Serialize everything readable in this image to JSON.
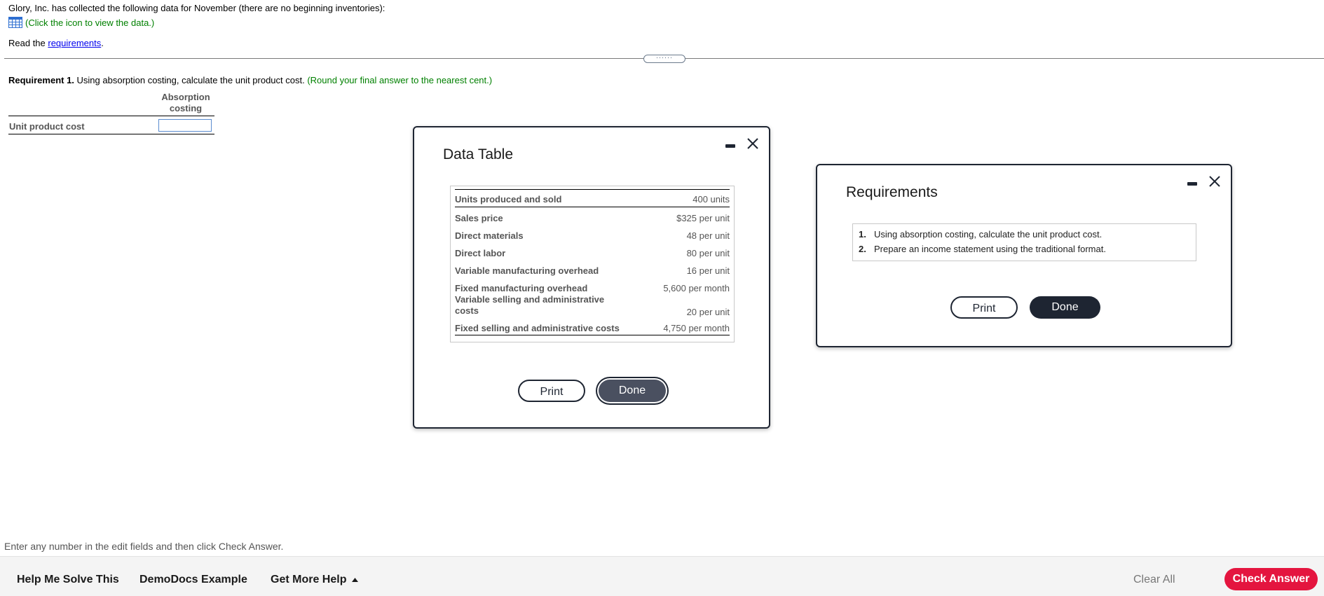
{
  "question": {
    "intro": "Glory, Inc. has collected the following data for November (there are no beginning inventories):",
    "data_link": "(Click the icon to view the data.)",
    "read_prefix": "Read the ",
    "read_link": "requirements",
    "read_suffix": ".",
    "req1_bold": "Requirement 1.",
    "req1_text": " Using absorption costing, calculate the unit product cost.",
    "req1_hint": " (Round your final answer to the nearest cent.)",
    "column_header": "Absorption costing",
    "row_label": "Unit product cost",
    "row_value": ""
  },
  "data_table_modal": {
    "title": "Data Table",
    "rows": [
      {
        "label": "Units produced and sold",
        "value": "400 units"
      },
      {
        "label": "Sales price",
        "value": "$325 per unit"
      },
      {
        "label": "Direct materials",
        "value": "48 per unit"
      },
      {
        "label": "Direct labor",
        "value": "80 per unit"
      },
      {
        "label": "Variable manufacturing overhead",
        "value": "16 per unit"
      },
      {
        "label": "Fixed manufacturing overhead",
        "value": "5,600 per month"
      },
      {
        "label": "Variable selling and administrative costs",
        "value": "20 per unit"
      },
      {
        "label": "Fixed selling and administrative costs",
        "value": "4,750 per month"
      }
    ],
    "print_label": "Print",
    "done_label": "Done"
  },
  "requirements_modal": {
    "title": "Requirements",
    "items": [
      {
        "num": "1.",
        "text": "Using absorption costing, calculate the unit product cost."
      },
      {
        "num": "2.",
        "text": "Prepare an income statement using the traditional format."
      }
    ],
    "print_label": "Print",
    "done_label": "Done"
  },
  "footer": {
    "hint": "Enter any number in the edit fields and then click Check Answer.",
    "help_me_solve": "Help Me Solve This",
    "demodocs": "DemoDocs Example",
    "get_more_help": "Get More Help",
    "clear_all": "Clear All",
    "check_answer": "Check Answer"
  },
  "colors": {
    "green_text": "#008000",
    "link_blue": "#0000ee",
    "modal_dark": "#1e2532",
    "check_answer_red": "#e4153f"
  },
  "icons": [
    "table-grid-icon",
    "minimize-icon",
    "close-icon",
    "caret-up-icon"
  ]
}
